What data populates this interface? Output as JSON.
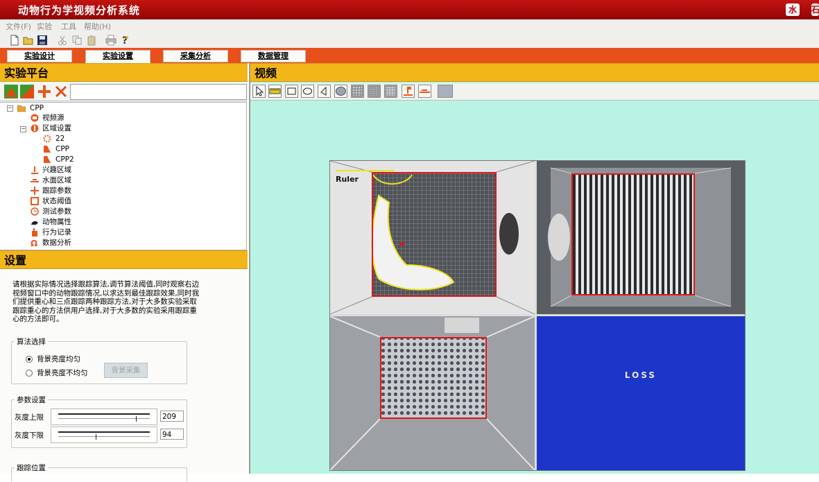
{
  "window": {
    "title": "动物行为学视频分析系统",
    "buttons": [
      "水",
      "石"
    ]
  },
  "menu": [
    "文件(F)",
    "实验",
    "工具",
    "帮助(H)"
  ],
  "tabs": [
    "实验设计",
    "实验设置",
    "采集分析",
    "数据管理"
  ],
  "left_panel": {
    "platform_title": "实验平台",
    "tree": {
      "root": "CPP",
      "items": [
        {
          "label": "视频源",
          "icon": "video-source-icon"
        },
        {
          "label": "区域设置",
          "icon": "region-settings-icon"
        },
        {
          "label": "22",
          "icon": "region-circle-icon"
        },
        {
          "label": "CPP",
          "icon": "region-shape-icon"
        },
        {
          "label": "CPP2",
          "icon": "region-shape-icon"
        },
        {
          "label": "兴趣区域",
          "icon": "interest-region-icon"
        },
        {
          "label": "水面区域",
          "icon": "water-region-icon"
        },
        {
          "label": "跟踪参数",
          "icon": "tracking-params-icon"
        },
        {
          "label": "状态阈值",
          "icon": "state-threshold-icon"
        },
        {
          "label": "测试参数",
          "icon": "test-params-icon"
        },
        {
          "label": "动物属性",
          "icon": "animal-attributes-icon"
        },
        {
          "label": "行为记录",
          "icon": "behavior-record-icon"
        },
        {
          "label": "数据分析",
          "icon": "data-analysis-icon"
        }
      ]
    },
    "settings_title": "设置",
    "description": "请根据实际情况选择跟踪算法,调节算法阈值,同时观察右边视频窗口中的动物跟踪情况,以求达到最佳跟踪效果,同时我们提供重心和三点跟踪两种跟踪方法,对于大多数实验采取跟踪重心的方法供用户选择,对于大多数的实验采用跟踪重心的方法即可。",
    "algorithm_group": {
      "title": "算法选择",
      "option_uniform": "背景亮度均匀",
      "option_nonuniform": "背景亮度不均匀",
      "capture_button": "背景采集"
    },
    "params_group": {
      "title": "参数设置",
      "upper_label": "灰度上限",
      "upper_value": "209",
      "lower_label": "灰度下限",
      "lower_value": "94"
    },
    "tracking_group": {
      "title": "跟踪位置"
    }
  },
  "right_panel": {
    "video_title": "视频",
    "ruler_label": "Ruler",
    "loss_label": "LOSS"
  }
}
